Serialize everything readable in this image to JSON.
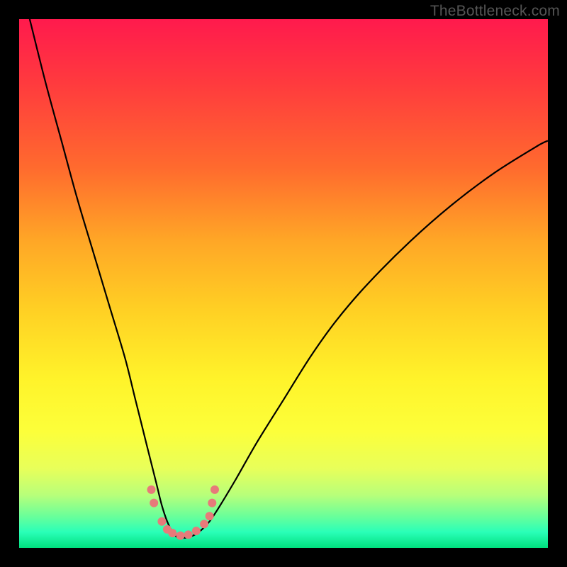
{
  "watermark": "TheBottleneck.com",
  "chart_data": {
    "type": "line",
    "title": "",
    "xlabel": "",
    "ylabel": "",
    "xlim": [
      0,
      100
    ],
    "ylim": [
      0,
      100
    ],
    "series": [
      {
        "name": "bottleneck-curve",
        "x": [
          2,
          5,
          8,
          11,
          14,
          17,
          20,
          22,
          24,
          26,
          27,
          28,
          29,
          30,
          32,
          34,
          36,
          38,
          41,
          45,
          50,
          55,
          60,
          66,
          74,
          82,
          90,
          98,
          100
        ],
        "y": [
          100,
          88,
          77,
          66,
          56,
          46,
          36,
          28,
          20,
          12,
          8,
          5,
          3,
          2,
          2,
          3,
          5,
          8,
          13,
          20,
          28,
          36,
          43,
          50,
          58,
          65,
          71,
          76,
          77
        ]
      }
    ],
    "markers": {
      "name": "highlight-dots",
      "points": [
        {
          "x": 25.0,
          "y": 11
        },
        {
          "x": 25.5,
          "y": 8.5
        },
        {
          "x": 27.0,
          "y": 5
        },
        {
          "x": 28.0,
          "y": 3.5
        },
        {
          "x": 29.0,
          "y": 2.8
        },
        {
          "x": 30.5,
          "y": 2.3
        },
        {
          "x": 32.0,
          "y": 2.5
        },
        {
          "x": 33.5,
          "y": 3.2
        },
        {
          "x": 35.0,
          "y": 4.5
        },
        {
          "x": 36.0,
          "y": 6
        },
        {
          "x": 36.5,
          "y": 8.5
        },
        {
          "x": 37.0,
          "y": 11
        }
      ],
      "radius": 6
    },
    "gradient_stops": [
      {
        "pos": 0,
        "color": "#ff1a4d"
      },
      {
        "pos": 42,
        "color": "#ffa726"
      },
      {
        "pos": 68,
        "color": "#fff32a"
      },
      {
        "pos": 100,
        "color": "#00e07e"
      }
    ]
  }
}
